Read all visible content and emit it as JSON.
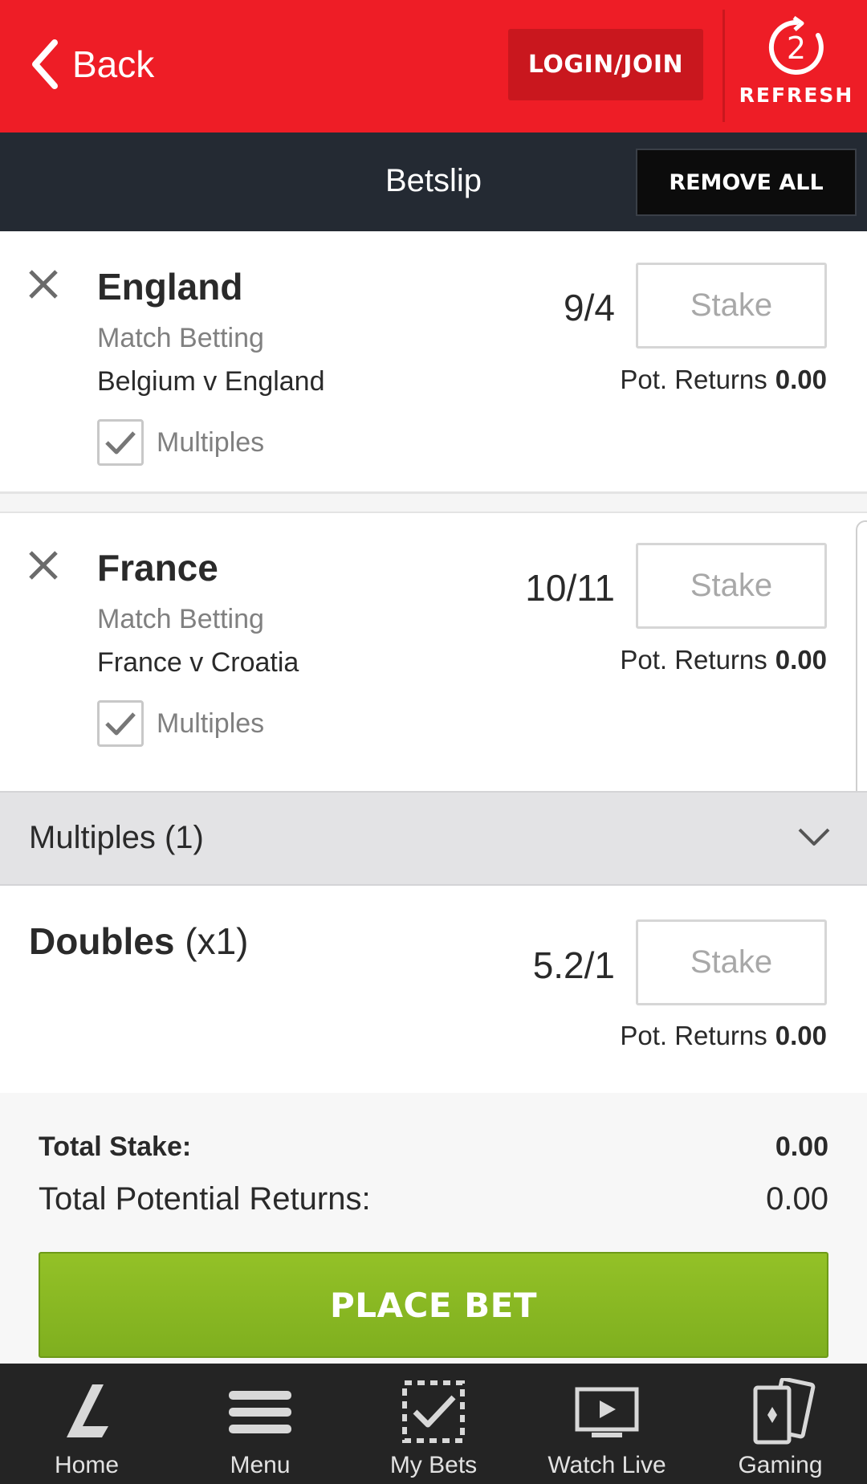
{
  "header": {
    "back_label": "Back",
    "login_label": "LOGIN/JOIN",
    "refresh_label": "REFRESH",
    "refresh_count": "2",
    "brand_color": "#ee1d26"
  },
  "betslip_bar": {
    "title": "Betslip",
    "remove_all_label": "REMOVE ALL"
  },
  "selections": [
    {
      "name": "England",
      "market": "Match Betting",
      "event": "Belgium v England",
      "multiples_label": "Multiples",
      "multiples_checked": true,
      "odds": "9/4",
      "stake_placeholder": "Stake",
      "returns_label": "Pot. Returns",
      "returns_value": "0.00"
    },
    {
      "name": "France",
      "market": "Match Betting",
      "event": "France v Croatia",
      "multiples_label": "Multiples",
      "multiples_checked": true,
      "odds": "10/11",
      "stake_placeholder": "Stake",
      "returns_label": "Pot. Returns",
      "returns_value": "0.00"
    }
  ],
  "multiples": {
    "header_label": "Multiples (1)",
    "doubles_name": "Doubles",
    "doubles_count": "(x1)",
    "doubles_odds": "5.2/1",
    "stake_placeholder": "Stake",
    "returns_label": "Pot. Returns",
    "returns_value": "0.00"
  },
  "totals": {
    "total_stake_label": "Total Stake:",
    "total_stake_value": "0.00",
    "total_returns_label": "Total Potential Returns:",
    "total_returns_value": "0.00",
    "place_bet_label": "PLACE BET",
    "place_bet_color": "#8ab726"
  },
  "bottom_nav": [
    {
      "label": "Home",
      "icon": "home-logo-icon"
    },
    {
      "label": "Menu",
      "icon": "menu-icon"
    },
    {
      "label": "My Bets",
      "icon": "my-bets-icon"
    },
    {
      "label": "Watch Live",
      "icon": "watch-live-icon"
    },
    {
      "label": "Gaming",
      "icon": "gaming-cards-icon"
    }
  ]
}
